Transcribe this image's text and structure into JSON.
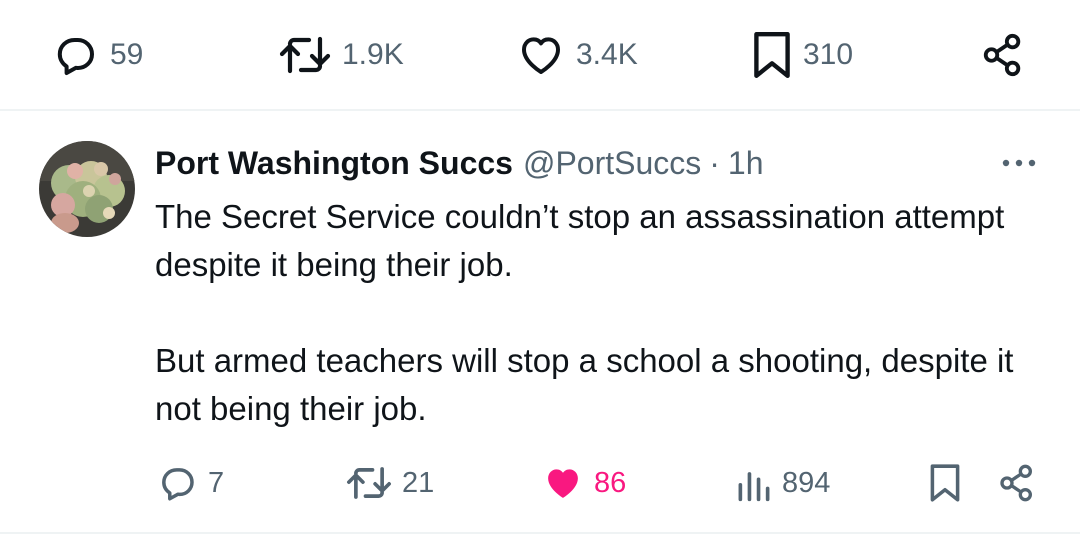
{
  "previous_tweet_actions": {
    "replies": "59",
    "retweets": "1.9K",
    "likes": "3.4K",
    "bookmarks": "310",
    "icons": [
      "reply-icon",
      "retweet-icon",
      "like-icon",
      "bookmark-icon",
      "share-icon"
    ]
  },
  "tweet": {
    "display_name": "Port Washington Succs",
    "handle": "@PortSuccs",
    "separator": "·",
    "time": "1h",
    "paragraphs": [
      "The Secret Service couldn’t stop an assassination attempt despite it being their job.",
      "But armed teachers will stop a school a shooting, despite it not being their job."
    ],
    "actions": {
      "replies": "7",
      "retweets": "21",
      "likes": "86",
      "views": "894",
      "liked": true,
      "icons": [
        "reply-icon",
        "retweet-icon",
        "like-icon-filled",
        "views-icon",
        "bookmark-icon",
        "share-icon"
      ]
    }
  },
  "colors": {
    "text": "#0f1419",
    "secondary": "#536471",
    "like_active": "#f91880",
    "divider": "#eff3f4"
  }
}
